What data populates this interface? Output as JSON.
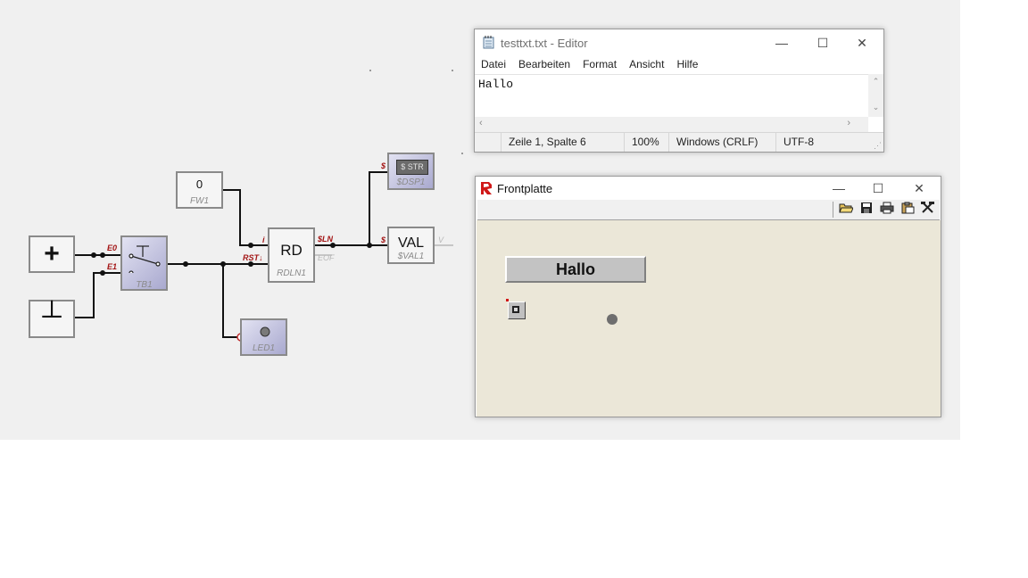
{
  "circuit": {
    "plus_label": "+",
    "ground_label": "┴",
    "switch_name": "TB1",
    "switch_pins": [
      "E0",
      "E1"
    ],
    "switch_symbol": "T",
    "fw_value": "0",
    "fw_name": "FW1",
    "rdln_label": "RD",
    "rdln_name": "RDLN1",
    "rdln_pins": {
      "i": "i",
      "rst": "RST↓",
      "sln": "$LN",
      "eof": "EOF"
    },
    "dsp_label": "$ STR",
    "dsp_name": "$DSP1",
    "dsp_pin": "$",
    "val_label": "VAL",
    "val_name": "$VAL1",
    "val_pin_in": "$",
    "val_pin_out": "V",
    "led_name": "LED1"
  },
  "editor": {
    "title": "testtxt.txt - Editor",
    "icon": "notepad-icon",
    "menu": [
      "Datei",
      "Bearbeiten",
      "Format",
      "Ansicht",
      "Hilfe"
    ],
    "content": "Hallo",
    "status": {
      "position": "Zeile 1, Spalte 6",
      "zoom": "100%",
      "line_ending": "Windows (CRLF)",
      "encoding": "UTF-8"
    }
  },
  "frontplatte": {
    "title": "Frontplatte",
    "icon": "app-logo-icon",
    "toolbar_icons": [
      "folder-open-icon",
      "save-icon",
      "print-icon",
      "clipboard-icon",
      "tools-icon"
    ],
    "display_text": "Hallo",
    "panel_color": "#ebe7d8"
  }
}
